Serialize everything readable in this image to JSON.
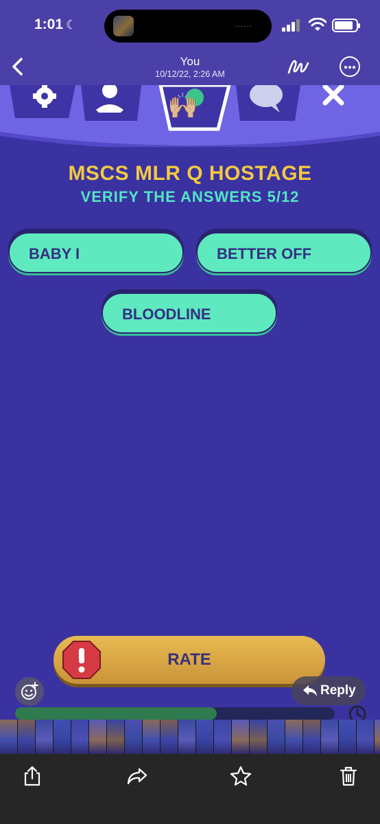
{
  "status_bar": {
    "time": "1:01",
    "focus_icon": "moon-icon",
    "island_dots": "......",
    "icons": [
      "cellular-signal-icon",
      "wifi-icon",
      "battery-icon"
    ]
  },
  "viewer_header": {
    "title": "You",
    "subtitle": "10/12/22, 2:26 AM",
    "icons": [
      "back-chevron-icon",
      "markup-pen-icon",
      "more-icon"
    ]
  },
  "game": {
    "nav_icons": [
      "gear-icon",
      "person-icon",
      "waving-hands-icon",
      "chat-bubble-icon",
      "close-icon"
    ],
    "emoji": "🙌🏼",
    "title": "MSCS MLR Q HOSTAGE",
    "subtitle": "VERIFY THE ANSWERS 5/12",
    "answers": [
      "BABY I",
      "BETTER OFF",
      "BLOODLINE"
    ],
    "rate_label": "RATE",
    "rate_icon": "exclamation-warning-icon",
    "colors": {
      "background": "#3a32a0",
      "title": "#f3c842",
      "subtitle": "#52e6c4",
      "answer_fill": "#5ee9be",
      "rate_fill": "#e8bb52",
      "warning": "#d63a45"
    }
  },
  "overlay": {
    "reaction_icon": "add-reaction-icon",
    "reply_label": "Reply",
    "reply_icon": "reply-arrow-icon",
    "video_progress": 0.63,
    "clock_icon": "clock-icon"
  },
  "toolbar": {
    "icons": [
      "share-icon",
      "forward-icon",
      "favorite-star-icon",
      "trash-icon"
    ]
  }
}
